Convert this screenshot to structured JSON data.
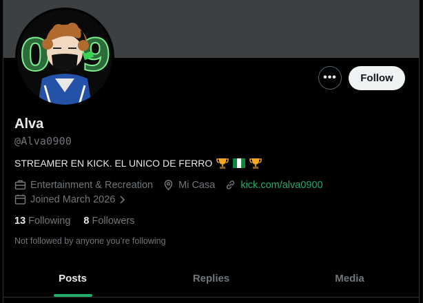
{
  "profile": {
    "name": "Alva",
    "handle": "@Alva0900",
    "bio": "STREAMER EN KICK. EL UNICO DE FERRO",
    "category": "Entertainment & Recreation",
    "location": "Mi Casa",
    "link": "kick.com/alva0900",
    "joined": "Joined March 2026",
    "following_count": "13",
    "following_label": "Following",
    "followers_count": "8",
    "followers_label": "Followers",
    "followed_note": "Not followed by anyone you’re following"
  },
  "actions": {
    "more": "•••",
    "follow": "Follow"
  },
  "tabs": [
    {
      "label": "Posts",
      "active": true
    },
    {
      "label": "Replies",
      "active": false
    },
    {
      "label": "Media",
      "active": false
    }
  ],
  "colors": {
    "accent": "#1fad66",
    "banner": "#3c4043",
    "muted": "#71767b"
  },
  "icons": {
    "trophy": "trophy-icon",
    "flag": "nigeria-flag-icon",
    "briefcase": "briefcase-icon",
    "location": "location-pin-icon",
    "link": "link-icon",
    "calendar": "calendar-icon"
  }
}
